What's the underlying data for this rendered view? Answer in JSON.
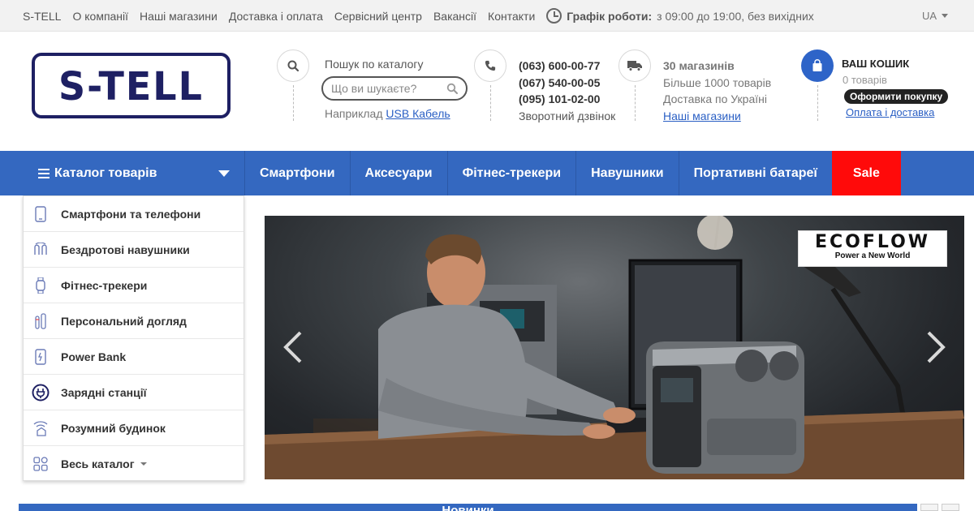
{
  "topbar": {
    "links": [
      "S-TELL",
      "О компанії",
      "Наші магазини",
      "Доставка і оплата",
      "Сервісний центр",
      "Вакансії",
      "Контакти"
    ],
    "hours_label": "Графік роботи:",
    "hours_value": "з 09:00 до 19:00, без вихідних",
    "language": "UA"
  },
  "header": {
    "logo_text": "S-TELL",
    "search": {
      "label": "Пошук по каталогу",
      "placeholder": "Що ви шукаєте?",
      "example_prefix": "Наприклад",
      "example_link": "USB Кабель"
    },
    "phones": {
      "numbers": [
        "(063) 600-00-77",
        "(067) 540-00-05",
        "(095) 101-02-00"
      ],
      "callback": "Зворотний дзвінок"
    },
    "stores": {
      "title": "30 магазинів",
      "line1": "Більше 1000 товарів",
      "line2": "Доставка по Україні",
      "link": "Наші магазини"
    },
    "cart": {
      "title": "ВАШ КОШИК",
      "count": "0 товарів",
      "checkout": "Оформити покупку",
      "delivery_link": "Оплата і доставка"
    }
  },
  "nav": {
    "catalog_label": "Каталог товарів",
    "tabs": [
      "Смартфони",
      "Аксесуари",
      "Фітнес-трекери",
      "Навушники",
      "Портативні батареї"
    ],
    "sale": "Sale",
    "sale_color": "#ff0a0a",
    "accent_color": "#3468c0"
  },
  "sidebar": {
    "items": [
      {
        "label": "Смартфони та телефони",
        "icon": "smartphone-icon"
      },
      {
        "label": "Бездротові навушники",
        "icon": "earbuds-icon"
      },
      {
        "label": "Фітнес-трекери",
        "icon": "fitness-tracker-icon"
      },
      {
        "label": "Персональний догляд",
        "icon": "personal-care-icon"
      },
      {
        "label": "Power Bank",
        "icon": "power-bank-icon"
      },
      {
        "label": "Зарядні станції",
        "icon": "charging-station-icon"
      },
      {
        "label": "Розумний будинок",
        "icon": "smart-home-icon"
      },
      {
        "label": "Весь каталог",
        "icon": "grid-icon"
      }
    ]
  },
  "banner": {
    "brand": "ECOFLOW",
    "tagline": "Power a New World"
  },
  "bottom": {
    "section_title": "Новинки"
  }
}
